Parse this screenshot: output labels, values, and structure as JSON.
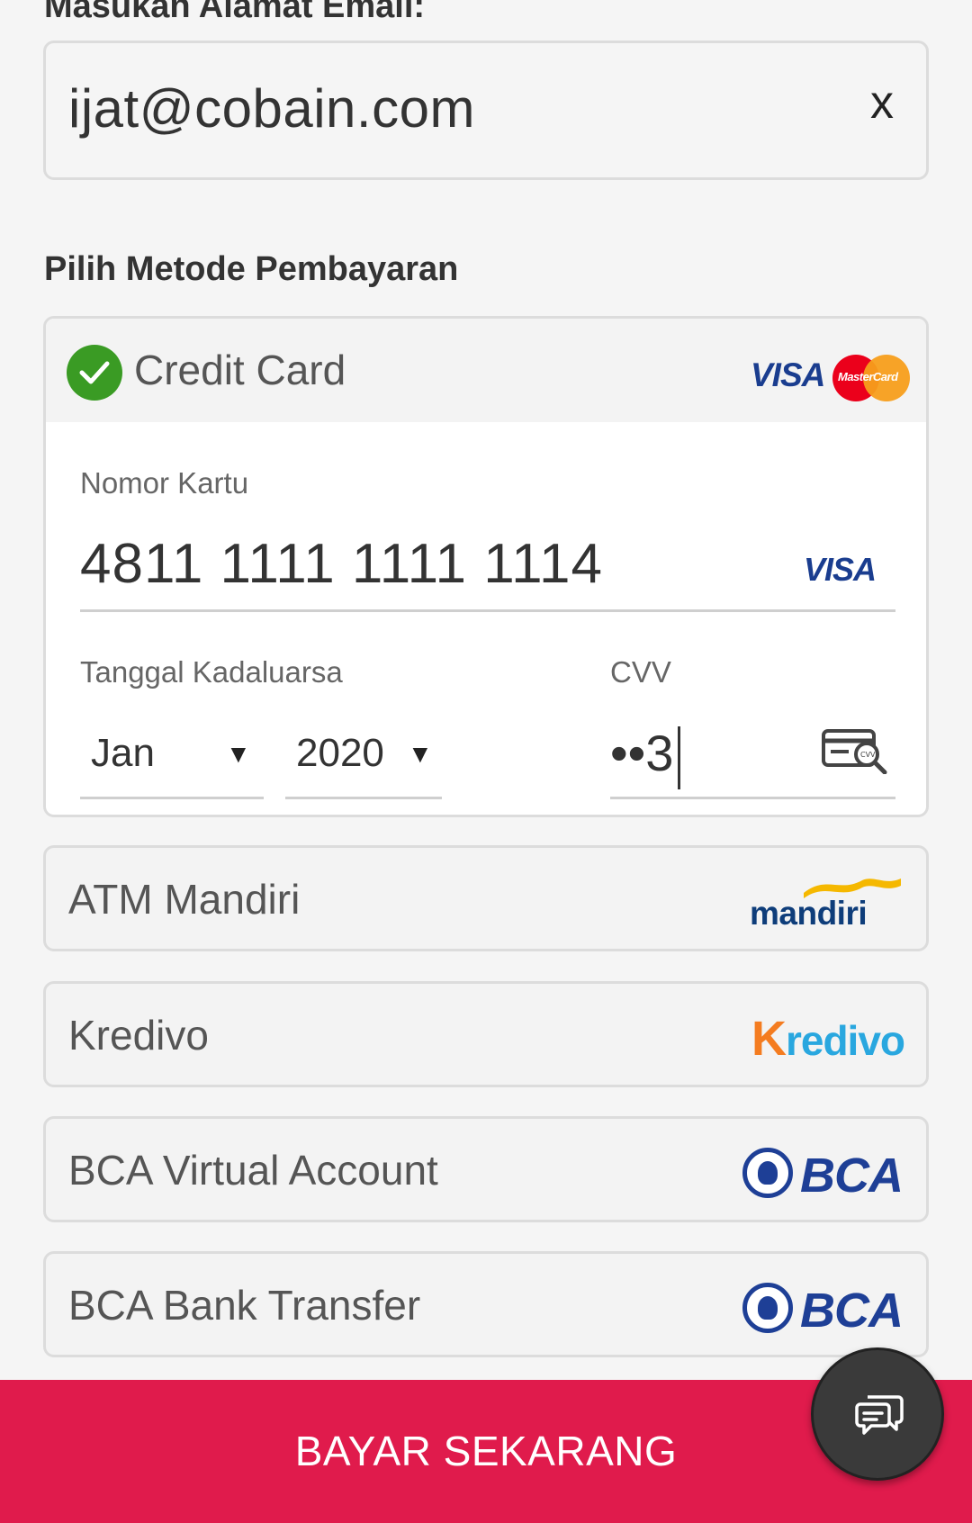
{
  "email": {
    "label": "Masukan Alamat Email:",
    "value": "ijat@cobain.com",
    "clear": "x"
  },
  "payment": {
    "title": "Pilih Metode Pembayaran",
    "credit_card": {
      "label": "Credit Card",
      "brand_visa": "VISA",
      "brand_mastercard": "MasterCard",
      "card_number_label": "Nomor Kartu",
      "card_number": "4811 1111 1111 1114",
      "card_brand": "VISA",
      "expiry_label": "Tanggal Kadaluarsa",
      "expiry_month": "Jan",
      "expiry_year": "2020",
      "caret": "▼",
      "cvv_label": "CVV",
      "cvv_value": "••3",
      "cvv_icon_text": "CVV"
    },
    "methods": [
      {
        "label": "ATM Mandiri",
        "logo": "mandiri"
      },
      {
        "label": "Kredivo",
        "logo": "Kredivo"
      },
      {
        "label": "BCA Virtual Account",
        "logo": "BCA"
      },
      {
        "label": "BCA Bank Transfer",
        "logo": "BCA"
      }
    ],
    "kredivo_k": "K",
    "kredivo_rest": "redivo"
  },
  "footer": {
    "pay_label": "BAYAR SEKARANG",
    "chat_icon": "chat-bubbles-icon"
  },
  "colors": {
    "pay_bar": "#e01b4c",
    "check": "#3a9b24",
    "bca_blue": "#1e3f96",
    "kredivo_blue": "#29a7df",
    "kredivo_orange": "#f47c20"
  }
}
